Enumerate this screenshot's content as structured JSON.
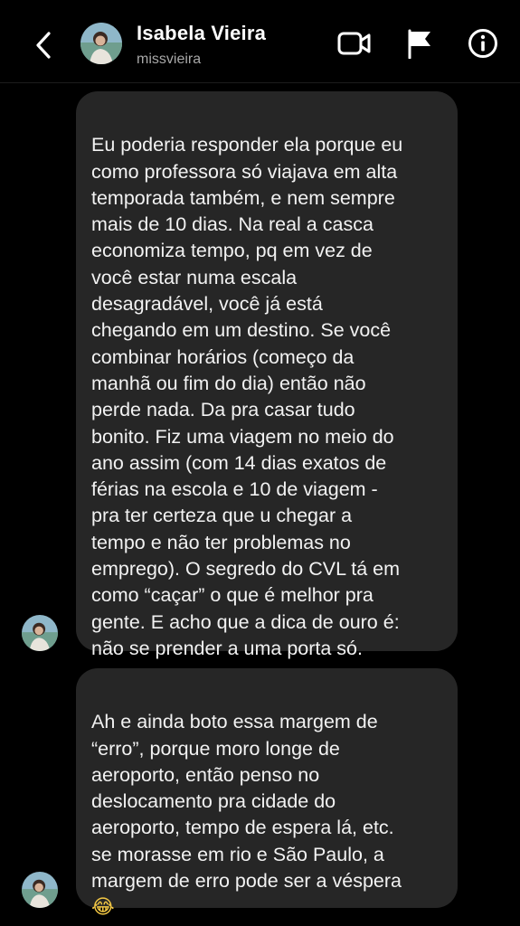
{
  "header": {
    "name": "Isabela Vieira",
    "username": "missvieira",
    "icons": {
      "back": "chevron-left-icon",
      "video": "video-camera-icon",
      "flag": "flag-icon",
      "info": "info-icon"
    }
  },
  "messages": [
    {
      "text": "Eu poderia responder ela porque eu\ncomo professora só viajava em alta\ntemporada também, e nem sempre\nmais de 10 dias. Na real a casca\neconomiza tempo, pq em vez de\nvocê estar numa escala\ndesagradável, você já está\nchegando em um destino. Se você\ncombinar horários (começo da\nmanhã ou fim do dia) então não\nperde nada. Da pra casar tudo\nbonito. Fiz uma viagem no meio do\nano assim (com 14 dias exatos de\nférias na escola e 10 de viagem -\npra ter certeza que u chegar a\ntempo e não ter problemas no\nemprego). O segredo do CVL tá em\ncomo “caçar” o que é melhor pra\ngente. E acho que a dica de ouro é:\nnão se prender a uma porta só."
    },
    {
      "text": "Ah e ainda boto essa margem de\n“erro”, porque moro longe de\naeroporto, então penso no\ndeslocamento pra cidade do\naeroporto, tempo de espera lá, etc.\nse morasse em rio e São Paulo, a\nmargem de erro pode ser a véspera\n",
      "emoji": "😂"
    }
  ],
  "colors": {
    "background": "#000000",
    "bubble": "#262626",
    "text": "#f2f2f2",
    "secondary": "#a8a8a8"
  }
}
